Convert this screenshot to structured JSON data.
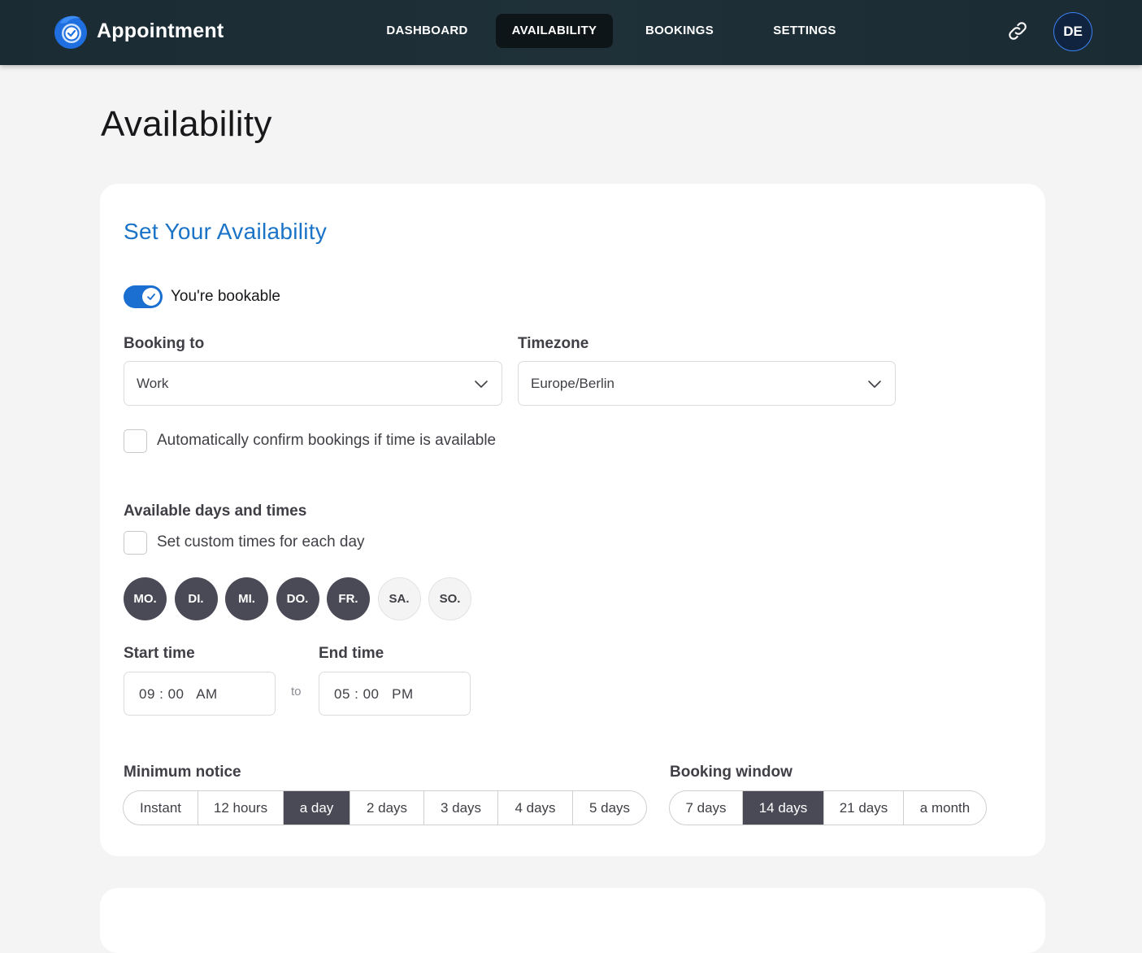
{
  "app": {
    "name": "Appointment",
    "avatar_initials": "DE"
  },
  "nav": [
    {
      "label": "DASHBOARD",
      "active": false
    },
    {
      "label": "AVAILABILITY",
      "active": true
    },
    {
      "label": "BOOKINGS",
      "active": false
    },
    {
      "label": "SETTINGS",
      "active": false
    }
  ],
  "page": {
    "title": "Availability"
  },
  "availability": {
    "heading": "Set Your Availability",
    "bookable_label": "You're bookable",
    "bookable_on": true,
    "booking_to": {
      "label": "Booking to",
      "value": "Work"
    },
    "timezone": {
      "label": "Timezone",
      "value": "Europe/Berlin"
    },
    "auto_confirm_label": "Automatically confirm bookings if time is available",
    "auto_confirm_checked": false,
    "days_section_label": "Available days and times",
    "custom_times_label": "Set custom times for each day",
    "custom_times_checked": false,
    "days": [
      {
        "label": "MO.",
        "selected": true
      },
      {
        "label": "DI.",
        "selected": true
      },
      {
        "label": "MI.",
        "selected": true
      },
      {
        "label": "DO.",
        "selected": true
      },
      {
        "label": "FR.",
        "selected": true
      },
      {
        "label": "SA.",
        "selected": false
      },
      {
        "label": "SO.",
        "selected": false
      }
    ],
    "start_time": {
      "label": "Start time",
      "value": "09 : 00   AM"
    },
    "to_label": "to",
    "end_time": {
      "label": "End time",
      "value": "05 : 00   PM"
    },
    "minimum_notice": {
      "label": "Minimum notice",
      "options": [
        "Instant",
        "12 hours",
        "a day",
        "2 days",
        "3 days",
        "4 days",
        "5 days"
      ],
      "selected": "a day"
    },
    "booking_window": {
      "label": "Booking window",
      "options": [
        "7 days",
        "14 days",
        "21 days",
        "a month"
      ],
      "selected": "14 days"
    }
  },
  "colors": {
    "accent": "#1a73c7",
    "toggle_on": "#1a6fd1",
    "selected_dark": "#4a4a57",
    "header_bg": "#1b2b34"
  }
}
